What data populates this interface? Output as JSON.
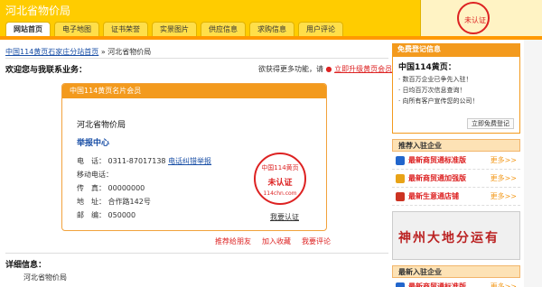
{
  "header": {
    "site_title": "河北省物价局",
    "stamp_text": "未认证"
  },
  "tabs": [
    {
      "label": "网站首页",
      "active": true
    },
    {
      "label": "电子地图"
    },
    {
      "label": "证书荣誉"
    },
    {
      "label": "实景图片"
    },
    {
      "label": "供应信息"
    },
    {
      "label": "求购信息"
    },
    {
      "label": "用户评论"
    }
  ],
  "breadcrumb": {
    "link": "中国114黄页石家庄分站首页",
    "separator": "»",
    "current": "河北省物价局"
  },
  "welcome": {
    "text": "欢迎您与我联系业务：",
    "want_more": "欲获得更多功能，请",
    "upgrade_link": "立即升级黄页会员"
  },
  "card": {
    "header": "中国114黄页名片会员",
    "name": "河北省物价局",
    "sub": "举报中心",
    "tel_label": "电　话：",
    "tel_value": "0311-87017138",
    "tel_link": "电话纠错举报",
    "mobile_label": "移动电话：",
    "mobile_value": "",
    "fax_label": "传　真：",
    "fax_value": "00000000",
    "addr_label": "地　址：",
    "addr_value": "合作路142号",
    "zip_label": "邮　编：",
    "zip_value": "050000",
    "seal_top": "中国114黄页",
    "seal_mid": "未认证",
    "seal_bot": "114chn.com",
    "confirm_link": "我要认证"
  },
  "actions": [
    "推荐给朋友",
    "加入收藏",
    "我要评论"
  ],
  "detail": {
    "title": "详细信息：",
    "text": "河北省物价局"
  },
  "right": {
    "reg_head": "免费登记信息",
    "reg_title": "中国114黄页：",
    "reg_items": [
      "· 数百万企业已争先入驻！",
      "· 日均百万次信息查询！",
      "· 向所有客户宣传您的公司！"
    ],
    "reg_button": "立即免费登记",
    "rec_head": "推荐入驻企业",
    "rec_items": [
      {
        "label": "最新商贸通标准版",
        "more": "更多>>",
        "color": "#2266cc"
      },
      {
        "label": "最新商贸通加强版",
        "more": "更多>>",
        "color": "#e8a317"
      },
      {
        "label": "最新生意通店铺",
        "more": "更多>>",
        "color": "#cc3322"
      }
    ],
    "ad_text": "神州大地分运有",
    "new_head": "最新入驻企业",
    "new_items": [
      {
        "label": "最新商贸通标准版",
        "more": "更多>>",
        "color": "#2266cc"
      }
    ]
  }
}
